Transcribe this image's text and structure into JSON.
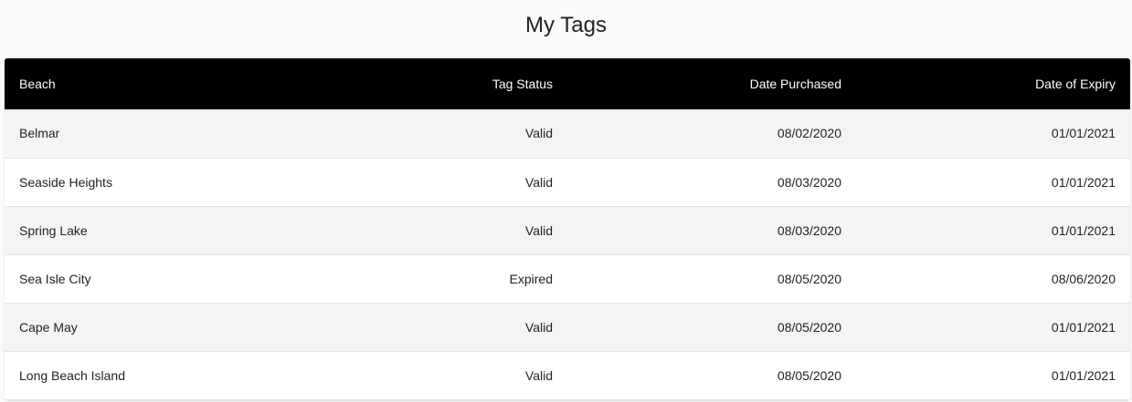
{
  "page": {
    "title": "My Tags"
  },
  "table": {
    "columns": [
      "Beach",
      "Tag Status",
      "Date Purchased",
      "Date of Expiry"
    ],
    "rows": [
      {
        "beach": "Belmar",
        "status": "Valid",
        "purchased": "08/02/2020",
        "expiry": "01/01/2021"
      },
      {
        "beach": "Seaside Heights",
        "status": "Valid",
        "purchased": "08/03/2020",
        "expiry": "01/01/2021"
      },
      {
        "beach": "Spring Lake",
        "status": "Valid",
        "purchased": "08/03/2020",
        "expiry": "01/01/2021"
      },
      {
        "beach": "Sea Isle City",
        "status": "Expired",
        "purchased": "08/05/2020",
        "expiry": "08/06/2020"
      },
      {
        "beach": "Cape May",
        "status": "Valid",
        "purchased": "08/05/2020",
        "expiry": "01/01/2021"
      },
      {
        "beach": "Long Beach Island",
        "status": "Valid",
        "purchased": "08/05/2020",
        "expiry": "01/01/2021"
      }
    ]
  },
  "colors": {
    "header_bg": "#000000",
    "header_text": "#ffffff",
    "row_odd": "#f4f4f4",
    "row_even": "#ffffff",
    "page_bg": "#fafafa"
  }
}
